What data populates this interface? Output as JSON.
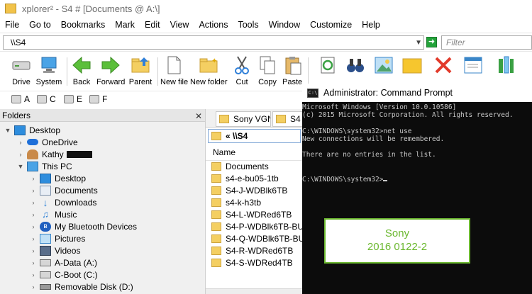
{
  "window": {
    "title": "xplorer² - S4 # [Documents @ A:\\]"
  },
  "menu": [
    "File",
    "Go to",
    "Bookmarks",
    "Mark",
    "Edit",
    "View",
    "Actions",
    "Tools",
    "Window",
    "Customize",
    "Help"
  ],
  "address": {
    "value": "\\\\S4",
    "filter_placeholder": "Filter"
  },
  "toolbar": {
    "buttons": [
      {
        "label": "Drive",
        "icon": "drive-icon"
      },
      {
        "label": "System",
        "icon": "computer-icon"
      },
      {
        "label": "Back",
        "icon": "back-arrow-icon"
      },
      {
        "label": "Forward",
        "icon": "forward-arrow-icon"
      },
      {
        "label": "Parent",
        "icon": "parent-folder-icon"
      },
      {
        "label": "New file",
        "icon": "new-file-icon"
      },
      {
        "label": "New folder",
        "icon": "new-folder-icon"
      },
      {
        "label": "Cut",
        "icon": "scissors-icon"
      },
      {
        "label": "Copy",
        "icon": "copy-icon"
      },
      {
        "label": "Paste",
        "icon": "paste-icon"
      }
    ]
  },
  "drives": [
    "A",
    "C",
    "E",
    "F"
  ],
  "folders": {
    "header": "Folders",
    "tree": [
      {
        "label": "Desktop",
        "level": 0,
        "expanded": true,
        "icon": "desktop-icon"
      },
      {
        "label": "OneDrive",
        "level": 1,
        "expanded": false,
        "icon": "cloud-icon"
      },
      {
        "label": "Kathy",
        "level": 1,
        "expanded": false,
        "icon": "user-icon"
      },
      {
        "label": "This PC",
        "level": 1,
        "expanded": true,
        "icon": "monitor-icon"
      },
      {
        "label": "Desktop",
        "level": 2,
        "expanded": false,
        "icon": "desktop-icon"
      },
      {
        "label": "Documents",
        "level": 2,
        "expanded": false,
        "icon": "documents-icon"
      },
      {
        "label": "Downloads",
        "level": 2,
        "expanded": false,
        "icon": "download-icon"
      },
      {
        "label": "Music",
        "level": 2,
        "expanded": false,
        "icon": "music-icon"
      },
      {
        "label": "My Bluetooth Devices",
        "level": 2,
        "expanded": false,
        "icon": "bluetooth-icon"
      },
      {
        "label": "Pictures",
        "level": 2,
        "expanded": false,
        "icon": "pictures-icon"
      },
      {
        "label": "Videos",
        "level": 2,
        "expanded": false,
        "icon": "videos-icon"
      },
      {
        "label": "A-Data (A:)",
        "level": 2,
        "expanded": false,
        "icon": "drive-icon"
      },
      {
        "label": "C-Boot (C:)",
        "level": 2,
        "expanded": false,
        "icon": "drive-icon"
      },
      {
        "label": "Removable Disk (D:)",
        "level": 2,
        "expanded": false,
        "icon": "usb-drive-icon"
      }
    ]
  },
  "files_pane": {
    "tabs": [
      "Sony VGN...",
      "S4"
    ],
    "path": "« \\\\S4",
    "column_name": "Name",
    "items": [
      "Documents",
      "s4-e-bu05-1tb",
      "S4-J-WDBlk6TB",
      "s4-k-h3tb",
      "S4-L-WDRed6TB",
      "S4-P-WDBlk6TB-BU",
      "S4-Q-WDBlk6TB-BU",
      "S4-R-WDRed6TB",
      "S4-S-WDRed4TB"
    ]
  },
  "cmd": {
    "title": "Administrator: Command Prompt",
    "lines": [
      "Microsoft Windows [Version 10.0.10586]",
      "(c) 2015 Microsoft Corporation. All rights reserved.",
      "",
      "C:\\WINDOWS\\system32>net use",
      "New connections will be remembered.",
      "",
      "There are no entries in the list.",
      "",
      "",
      "C:\\WINDOWS\\system32>"
    ]
  },
  "label_box": {
    "line1": "Sony",
    "line2": "2016 0122-2",
    "color": "#6bb82f"
  }
}
